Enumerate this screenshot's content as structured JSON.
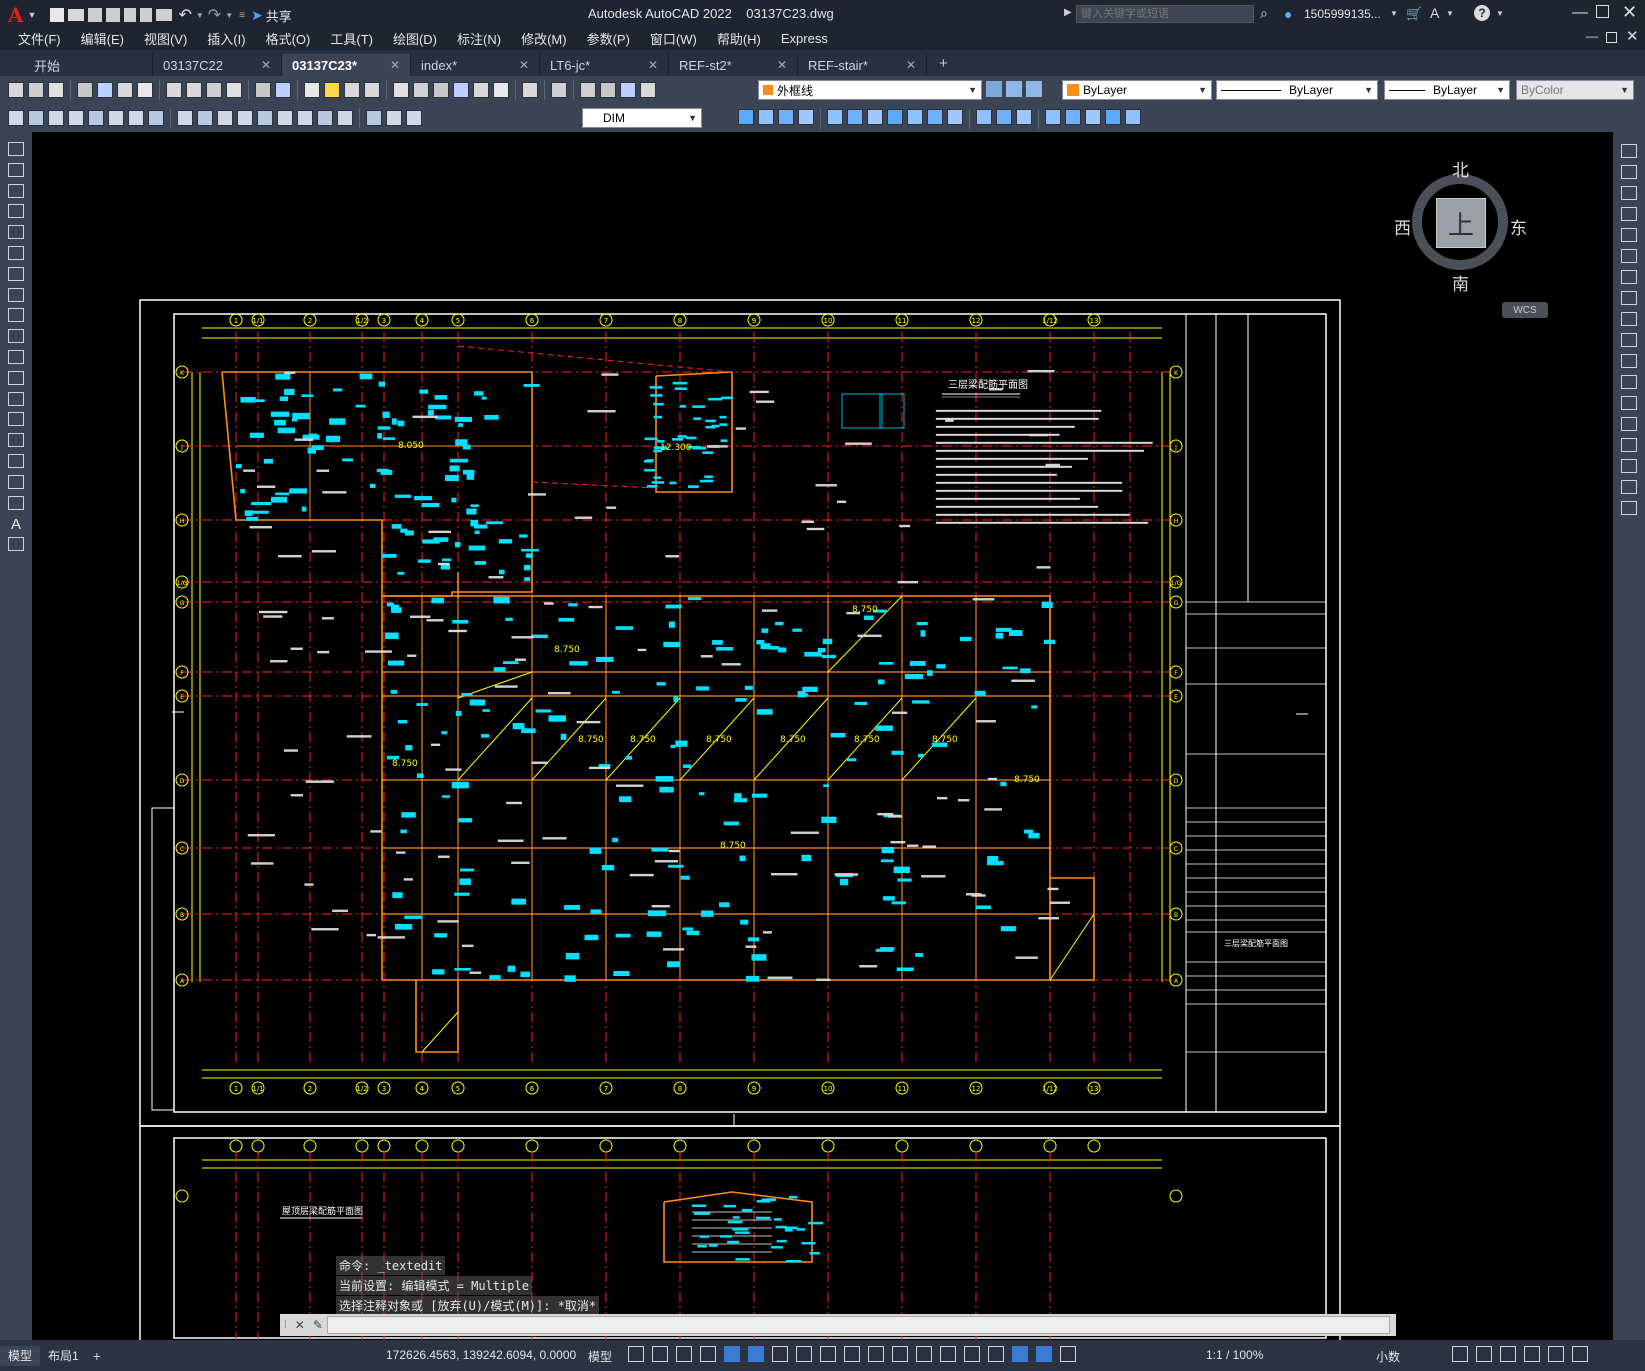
{
  "titlebar": {
    "share_label": "共享",
    "title": "Autodesk AutoCAD 2022    03137C23.dwg",
    "search_placeholder": "键入关键字或短语",
    "user": "1505999135...",
    "logo_letter": "A"
  },
  "menu": [
    "文件(F)",
    "编辑(E)",
    "视图(V)",
    "插入(I)",
    "格式(O)",
    "工具(T)",
    "绘图(D)",
    "标注(N)",
    "修改(M)",
    "参数(P)",
    "窗口(W)",
    "帮助(H)",
    "Express"
  ],
  "tabs": [
    {
      "label": "开始",
      "closable": false
    },
    {
      "label": "03137C22",
      "closable": true
    },
    {
      "label": "03137C23*",
      "closable": true,
      "active": true
    },
    {
      "label": "index*",
      "closable": true
    },
    {
      "label": "LT6-jc*",
      "closable": true
    },
    {
      "label": "REF-st2*",
      "closable": true
    },
    {
      "label": "REF-stair*",
      "closable": true
    }
  ],
  "toolbar1": {
    "layer": "外框线",
    "color": "ByLayer",
    "linetype": "ByLayer",
    "lineweight": "ByLayer",
    "plotstyle": "ByColor"
  },
  "toolbar2": {
    "dimstyle": "DIM"
  },
  "viewcube": {
    "north": "北",
    "south": "南",
    "east": "东",
    "west": "西",
    "top": "上",
    "wcs": "WCS"
  },
  "drawing": {
    "title_main": "三层梁配筋平面图",
    "title_block_title": "三层梁配筋平面图",
    "lower_title": "屋顶层梁配筋平面图",
    "grid_numbers": [
      "1",
      "1/1",
      "2",
      "1/2",
      "3",
      "4",
      "5",
      "6",
      "7",
      "8",
      "9",
      "10",
      "11",
      "12",
      "1/12",
      "13"
    ],
    "grid_letters": [
      "K",
      "J",
      "H",
      "1/G",
      "G",
      "F",
      "E",
      "D",
      "C",
      "B",
      "A"
    ],
    "elevation": "8.750",
    "elevation_alt": "12.300",
    "elevation_low": "8.050"
  },
  "command": {
    "line1": "命令:  _textedit",
    "line2": "当前设置: 编辑模式 = Multiple",
    "line3": "选择注释对象或 [放弃(U)/模式(M)]: *取消*"
  },
  "status": {
    "tab_model": "模型",
    "tab_layout": "布局1",
    "coords": "172626.4563, 139242.6094, 0.0000",
    "model_label": "模型",
    "scale": "1:1 / 100%",
    "units": "小数"
  },
  "colors": {
    "yellow": "#ffff00",
    "red": "#ff2020",
    "cyan": "#00e0ff",
    "orange": "#ff8c1a",
    "white": "#ffffff",
    "ui_dark": "#1e2430"
  }
}
